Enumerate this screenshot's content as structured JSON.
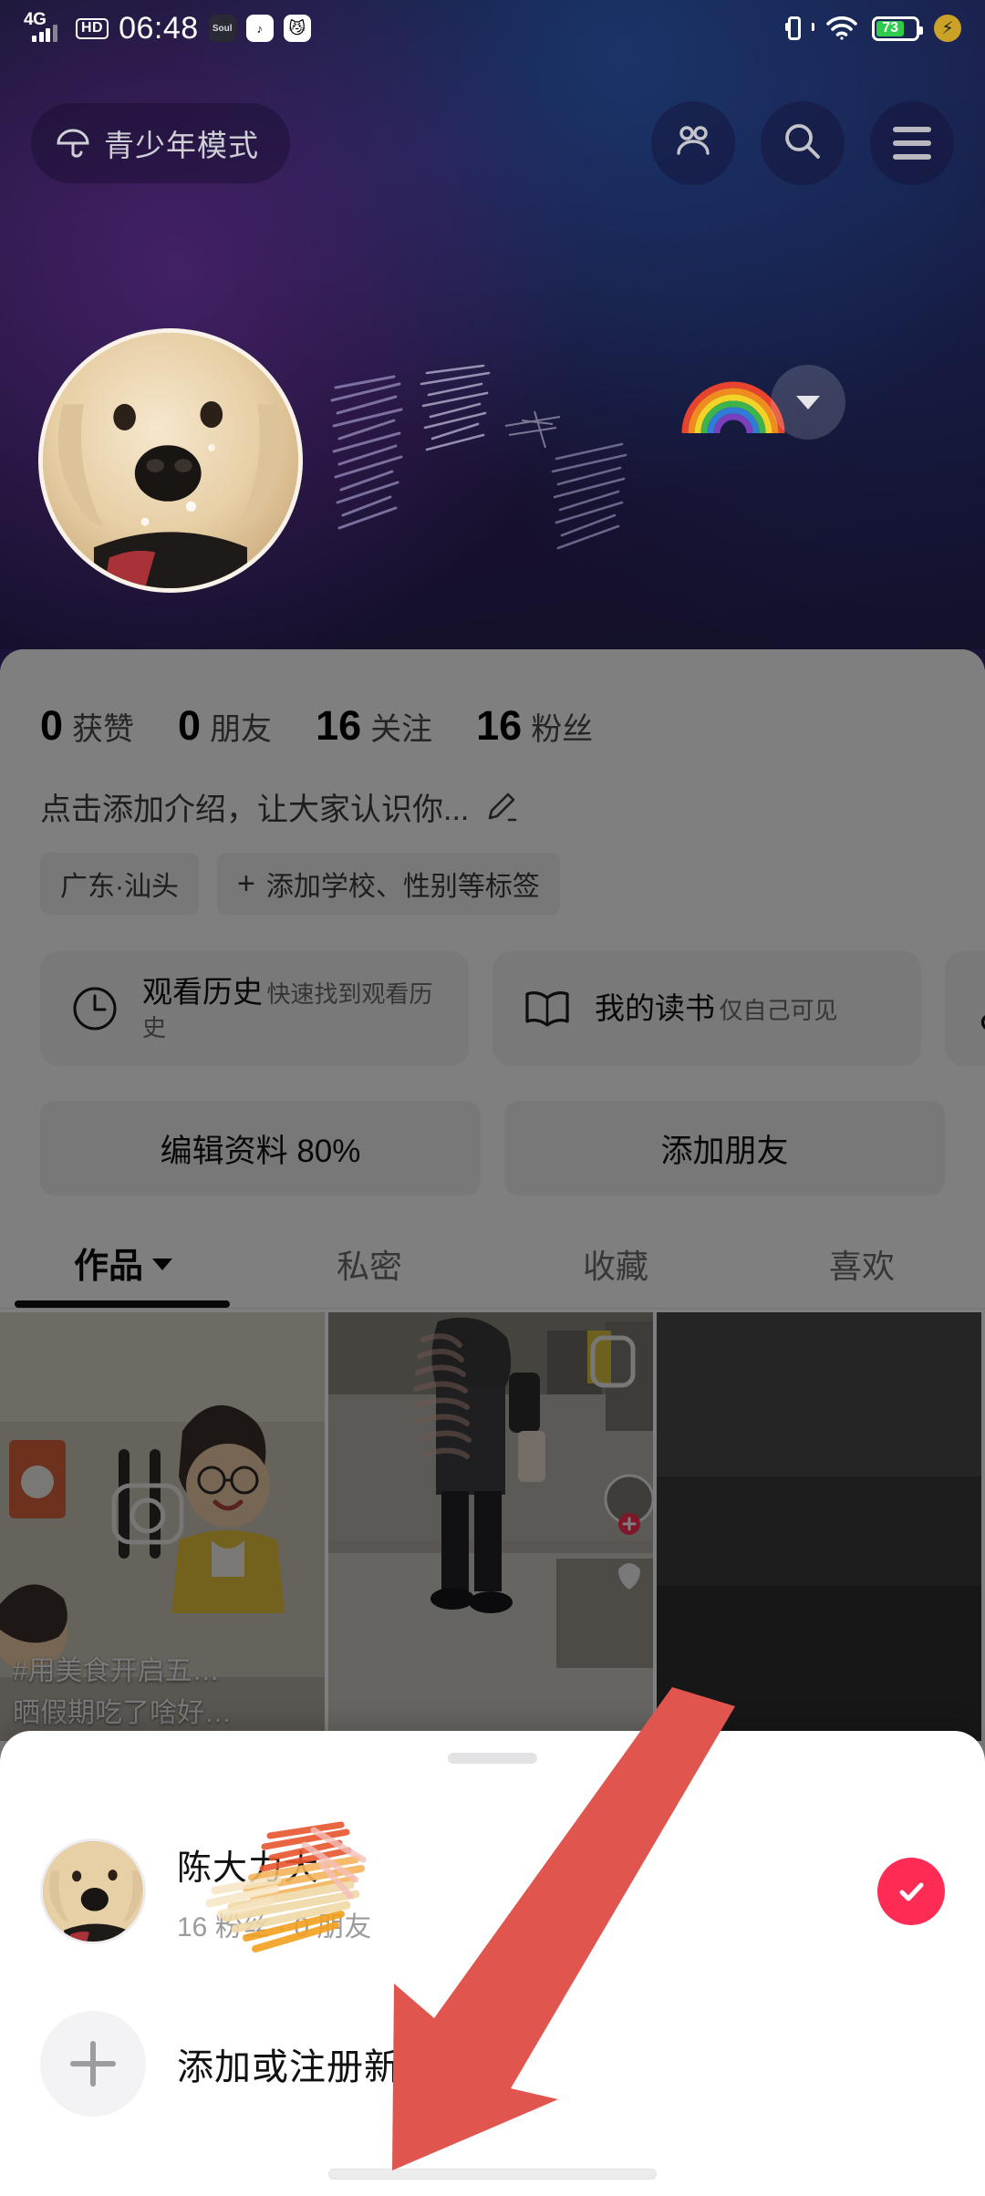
{
  "status_bar": {
    "network": "4G",
    "hd": "HD",
    "time": "06:48",
    "app_icons": [
      {
        "name": "soul-app-icon",
        "glyph": "Soul"
      },
      {
        "name": "douyin-app-icon",
        "glyph": "♪"
      },
      {
        "name": "cat-app-icon",
        "glyph": "😼"
      }
    ],
    "vibrate_icon": "vibrate-icon",
    "wifi_icon": "wifi-icon",
    "battery_percent": "73",
    "charge_icon": "flash-icon"
  },
  "top_nav": {
    "teen_mode_label": "青少年模式",
    "umbrella_icon": "umbrella-icon",
    "friends_icon": "friends-icon",
    "search_icon": "search-icon",
    "menu_icon": "hamburger-menu-icon"
  },
  "profile_header": {
    "avatar_alt": "golden-retriever-avatar",
    "username_redacted": "",
    "rainbow_emoji": "🌈",
    "expand_icon": "chevron-down-icon"
  },
  "stats": [
    {
      "num": "0",
      "label": "获赞"
    },
    {
      "num": "0",
      "label": "朋友"
    },
    {
      "num": "16",
      "label": "关注"
    },
    {
      "num": "16",
      "label": "粉丝"
    }
  ],
  "bio": {
    "placeholder": "点击添加介绍，让大家认识你...",
    "edit_icon": "pencil-edit-icon",
    "tags": [
      {
        "name": "location-tag",
        "label": "广东·汕头",
        "has_plus": false
      },
      {
        "name": "add-tags-tag",
        "label": "添加学校、性别等标签",
        "has_plus": true
      }
    ]
  },
  "cards": [
    {
      "name": "watch-history-card",
      "icon": "clock-icon",
      "title": "观看历史",
      "subtitle": "快速找到观看历史"
    },
    {
      "name": "my-reading-card",
      "icon": "book-icon",
      "title": "我的读书",
      "subtitle": "仅自己可见"
    },
    {
      "name": "my-music-card",
      "icon": "music-note-icon",
      "title": "",
      "subtitle": ""
    }
  ],
  "actions": [
    {
      "name": "edit-profile-button",
      "label": "编辑资料 80%"
    },
    {
      "name": "add-friend-button",
      "label": "添加朋友"
    }
  ],
  "tabs": [
    {
      "name": "tab-works",
      "label": "作品",
      "active": true,
      "has_caret": true
    },
    {
      "name": "tab-private",
      "label": "私密",
      "active": false,
      "has_caret": false
    },
    {
      "name": "tab-favorites",
      "label": "收藏",
      "active": false,
      "has_caret": false
    },
    {
      "name": "tab-likes",
      "label": "喜欢",
      "active": false,
      "has_caret": false
    }
  ],
  "video_grid": [
    {
      "name": "video-thumb-1",
      "caption1": "#用美食开启五…",
      "caption2": "晒假期吃了啥好…"
    },
    {
      "name": "video-thumb-2",
      "caption1": "",
      "caption2": ""
    },
    {
      "name": "video-thumb-3",
      "caption1": "",
      "caption2": ""
    }
  ],
  "bottom_sheet": {
    "drag_handle": "sheet-drag-handle",
    "account": {
      "avatar_alt": "golden-retriever-avatar",
      "name": "陈大力大",
      "stats": "16 粉丝 · 0 朋友",
      "selected": true,
      "check_icon": "check-circle-icon"
    },
    "add_account": {
      "plus_icon": "plus-icon",
      "label": "添加或注册新账号"
    }
  },
  "annotation": {
    "arrow_icon": "red-pointer-arrow",
    "arrow_color": "#E0564F"
  },
  "colors": {
    "accent_red": "#FE2C55",
    "annotation_red": "#E0564F",
    "battery_green": "#2ECC4A",
    "sheet_bg": "#FFFFFF",
    "card_bg": "#F2F2F4"
  }
}
